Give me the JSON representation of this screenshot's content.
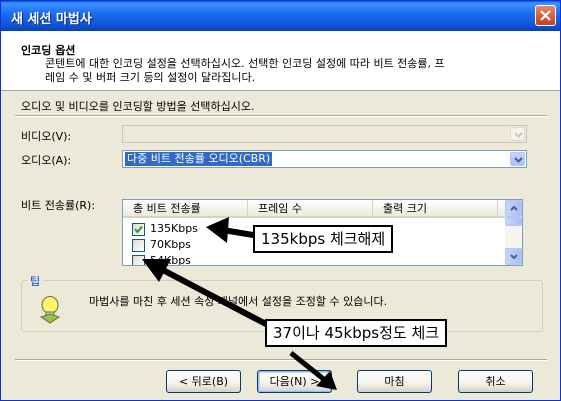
{
  "window": {
    "title": "새 세션 마법사"
  },
  "header": {
    "title": "인코딩 옵션",
    "description_line1": "콘텐트에 대한 인코딩 설정을 선택하십시오. 선택한 인코딩 설정에 따라 비트 전송률, 프",
    "description_line2": "레임 수 및 버퍼 크기 등의 설정이 달라집니다."
  },
  "instruction": "오디오 및 비디오를 인코딩할 방법을 선택하십시오.",
  "video": {
    "label": "비디오(V):",
    "value": "",
    "enabled": false
  },
  "audio": {
    "label": "오디오(A):",
    "value": "다중 비트 전송률 오디오(CBR)"
  },
  "bitrate": {
    "label": "비트 전송률(R):",
    "columns": [
      "총 비트 전송률",
      "프레임 수",
      "출력 크기"
    ],
    "rows": [
      {
        "label": "135Kbps",
        "checked": true
      },
      {
        "label": "70Kbps",
        "checked": false
      },
      {
        "label": "54Kbps",
        "checked": false
      }
    ]
  },
  "tip": {
    "title": "팁",
    "text": "마법사를 마친 후 세션 속성 패널에서 설정을 조정할 수 있습니다."
  },
  "buttons": {
    "back": "< 뒤로(B)",
    "next": "다음(N) >",
    "finish": "마침",
    "cancel": "취소"
  },
  "annotations": {
    "uncheck_note": "135kbps 체크해제",
    "check_note": "37이나 45kbps정도 체크"
  },
  "colors": {
    "titlebar": "#0a4fd0",
    "selection": "#316ac5",
    "tip_title": "#0046d5",
    "dialog_bg": "#ece9d8"
  },
  "icons": {
    "close": "close-icon",
    "dropdown": "chevron-down-icon",
    "tip": "lightbulb-icon",
    "scroll_up": "scroll-up-icon",
    "scroll_down": "scroll-down-icon",
    "checkbox_checked": "check-icon"
  }
}
